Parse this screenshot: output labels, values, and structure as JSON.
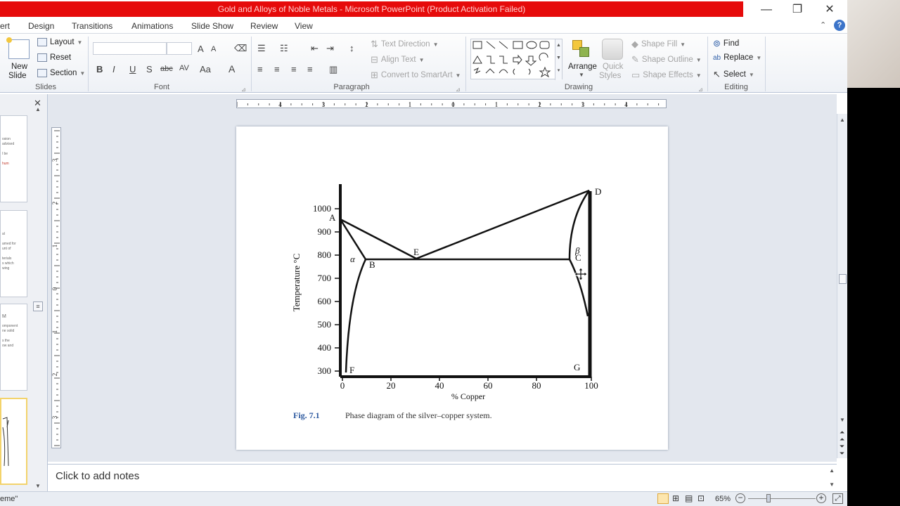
{
  "app": {
    "title": "Gold and Alloys of Noble Metals  -  Microsoft PowerPoint (Product Activation Failed)"
  },
  "window": {
    "minimize": "—",
    "restore": "❐",
    "close": "✕"
  },
  "tabs": [
    {
      "label": "ert"
    },
    {
      "label": "Design"
    },
    {
      "label": "Transitions"
    },
    {
      "label": "Animations"
    },
    {
      "label": "Slide Show"
    },
    {
      "label": "Review"
    },
    {
      "label": "View"
    }
  ],
  "ribbon": {
    "slides": {
      "group_label": "Slides",
      "new_slide_1": "New",
      "new_slide_2": "Slide",
      "layout": "Layout",
      "reset": "Reset",
      "section": "Section"
    },
    "font": {
      "group_label": "Font",
      "bold": "B",
      "italic": "I",
      "underline": "U",
      "strike": "S",
      "abc": "abc",
      "av": "AV",
      "aa": "Aa",
      "grow": "A",
      "shrink": "A",
      "color": "A"
    },
    "paragraph": {
      "group_label": "Paragraph",
      "text_direction": "Text Direction",
      "align_text": "Align Text",
      "convert_smartart": "Convert to SmartArt"
    },
    "drawing": {
      "group_label": "Drawing",
      "arrange": "Arrange",
      "quick_styles_1": "Quick",
      "quick_styles_2": "Styles",
      "shape_fill": "Shape Fill",
      "shape_outline": "Shape Outline",
      "shape_effects": "Shape Effects"
    },
    "editing": {
      "group_label": "Editing",
      "find": "Find",
      "replace": "Replace",
      "select": "Select"
    }
  },
  "ruler": {
    "h_labels": [
      "4",
      "3",
      "2",
      "1",
      "0",
      "1",
      "2",
      "3",
      "4"
    ],
    "v_labels": [
      "3",
      "2",
      "1",
      "0",
      "1",
      "2",
      "3"
    ]
  },
  "thumbnails": [
    {
      "lines": [
        "osion",
        "advised",
        "",
        "l be",
        "",
        "hum"
      ]
    },
    {
      "lines": [
        "al",
        "",
        "amed for",
        "unt of",
        "",
        "terials",
        "s which",
        "wing"
      ]
    },
    {
      "lines": [
        "M",
        "",
        "omponent",
        "ne solid",
        "",
        "s the",
        "ow and"
      ]
    },
    {
      "lines": []
    }
  ],
  "diagram": {
    "title_label": "Fig. 7.1",
    "title_text": "Phase diagram of the silver–copper system.",
    "x_axis_label": "% Copper",
    "y_axis_label": "Temperature °C",
    "x_ticks": [
      "0",
      "20",
      "40",
      "60",
      "80",
      "100"
    ],
    "y_ticks": [
      "1000",
      "900",
      "800",
      "700",
      "600",
      "500",
      "400",
      "300"
    ],
    "points": {
      "A": "A",
      "B": "B",
      "C": "C",
      "D": "D",
      "E": "E",
      "F": "F",
      "G": "G",
      "alpha": "α",
      "beta": "β"
    }
  },
  "notes": {
    "placeholder": "Click to add notes"
  },
  "status": {
    "theme": "eme\"",
    "zoom": "65%"
  }
}
